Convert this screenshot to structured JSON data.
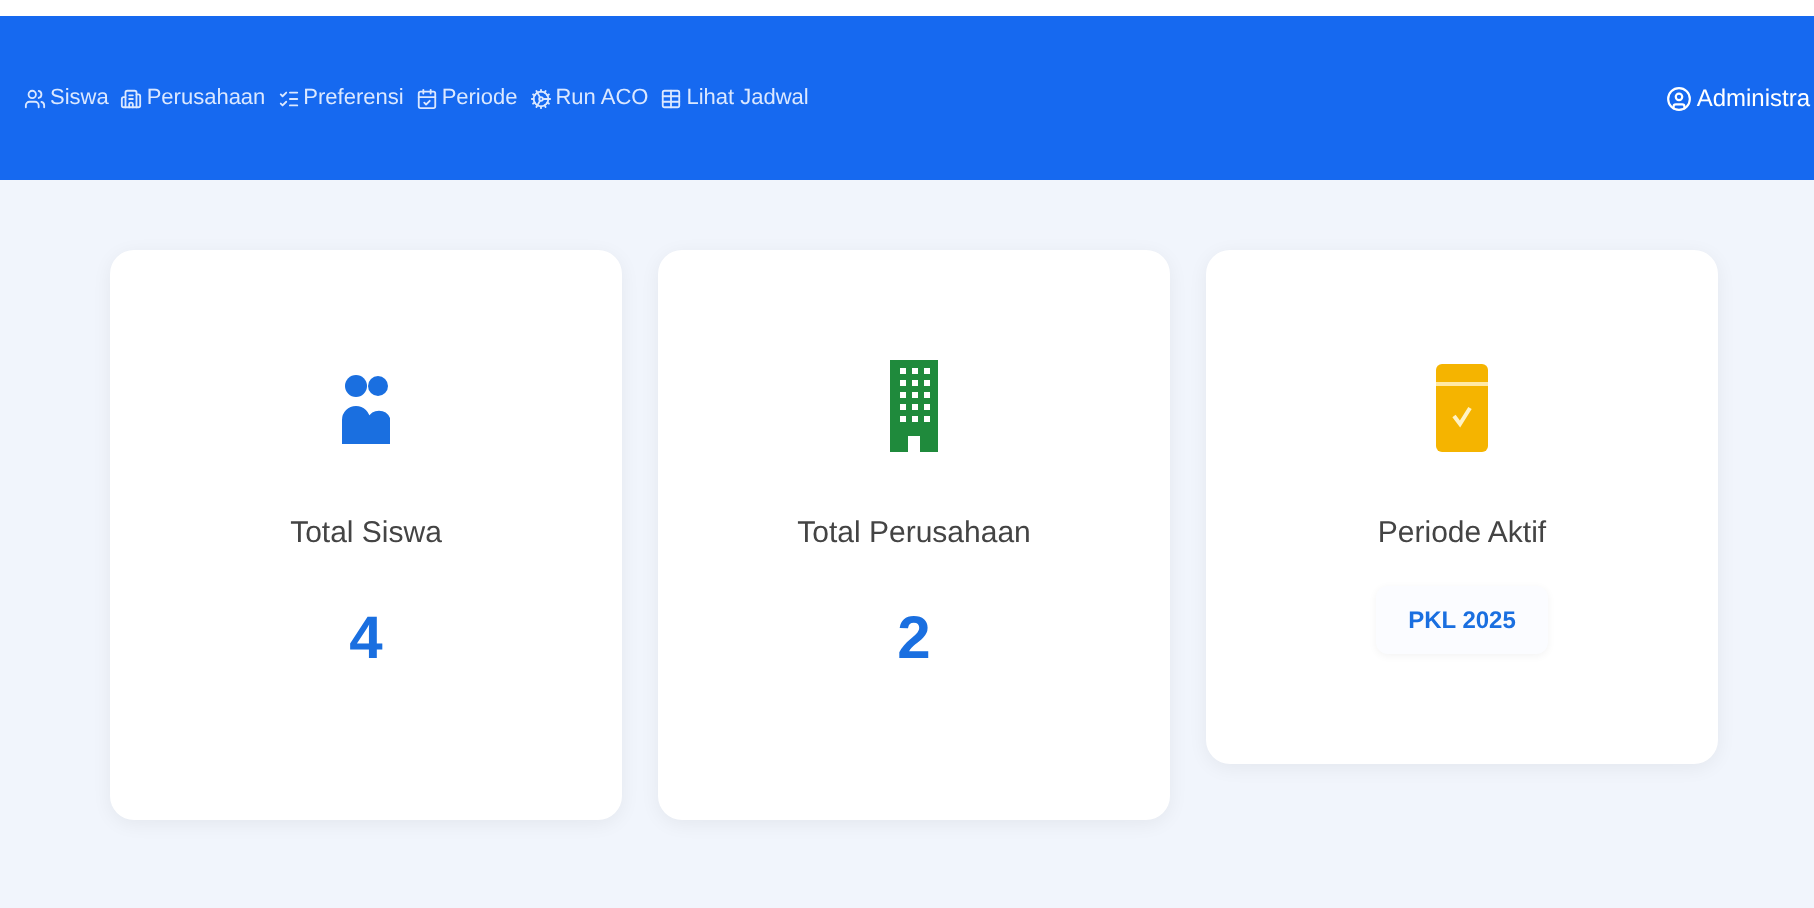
{
  "navbar": {
    "links": [
      {
        "label": "Siswa",
        "kind": "users"
      },
      {
        "label": "Perusahaan",
        "kind": "building"
      },
      {
        "label": "Preferensi",
        "kind": "list"
      },
      {
        "label": "Periode",
        "kind": "calendar"
      },
      {
        "label": "Run ACO",
        "kind": "run"
      },
      {
        "label": "Lihat Jadwal",
        "kind": "table"
      }
    ],
    "user": "Administra"
  },
  "stats": [
    {
      "kind": "students",
      "color": "#1a6fe0",
      "label": "Total Siswa",
      "value": "4"
    },
    {
      "kind": "companies",
      "color": "#1f8a3c",
      "label": "Total Perusahaan",
      "value": "2"
    },
    {
      "kind": "period",
      "color": "#f5b400",
      "label": "Periode Aktif",
      "value": "PKL 2025"
    }
  ]
}
